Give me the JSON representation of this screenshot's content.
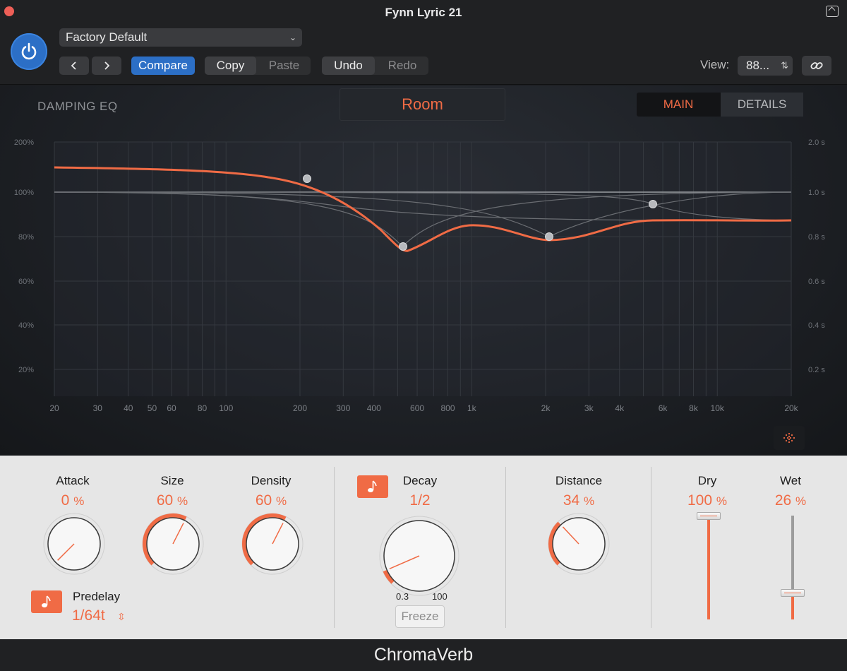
{
  "window": {
    "title": "Fynn Lyric 21"
  },
  "header": {
    "preset": "Factory Default",
    "prev_label": "‹",
    "next_label": "›",
    "compare_label": "Compare",
    "copy_label": "Copy",
    "paste_label": "Paste",
    "undo_label": "Undo",
    "redo_label": "Redo",
    "view_label": "View:",
    "view_value": "88...",
    "accent_color": "#2c6fc6"
  },
  "display": {
    "eq_title": "DAMPING EQ",
    "room_type": "Room",
    "tabs": [
      {
        "label": "MAIN",
        "active": true
      },
      {
        "label": "DETAILS",
        "active": false
      }
    ],
    "left_axis": [
      "200%",
      "100%",
      "80%",
      "60%",
      "40%",
      "20%"
    ],
    "right_axis": [
      "2.0 s",
      "1.0 s",
      "0.8 s",
      "0.6 s",
      "0.4 s",
      "0.2 s"
    ],
    "freq_axis": [
      "20",
      "30",
      "40",
      "50",
      "60",
      "80",
      "100",
      "200",
      "300",
      "400",
      "600",
      "800",
      "1k",
      "2k",
      "3k",
      "4k",
      "6k",
      "8k",
      "10k",
      "20k"
    ],
    "curve_color": "#f06b45"
  },
  "controls": {
    "attack": {
      "label": "Attack",
      "value": "0",
      "unit": "%",
      "level": 0.0
    },
    "size": {
      "label": "Size",
      "value": "60",
      "unit": "%",
      "level": 0.6
    },
    "density": {
      "label": "Density",
      "value": "60",
      "unit": "%",
      "level": 0.6
    },
    "predelay": {
      "label": "Predelay",
      "value": "1/64t"
    },
    "decay": {
      "label": "Decay",
      "value": "1/2",
      "range_min": "0.3",
      "range_max": "100",
      "level": 0.08
    },
    "freeze_label": "Freeze",
    "distance": {
      "label": "Distance",
      "value": "34",
      "unit": "%",
      "level": 0.34
    },
    "dry": {
      "label": "Dry",
      "value": "100",
      "unit": "%",
      "level": 1.0
    },
    "wet": {
      "label": "Wet",
      "value": "26",
      "unit": "%",
      "level": 0.26
    }
  },
  "footer": {
    "plugin_name": "ChromaVerb"
  }
}
